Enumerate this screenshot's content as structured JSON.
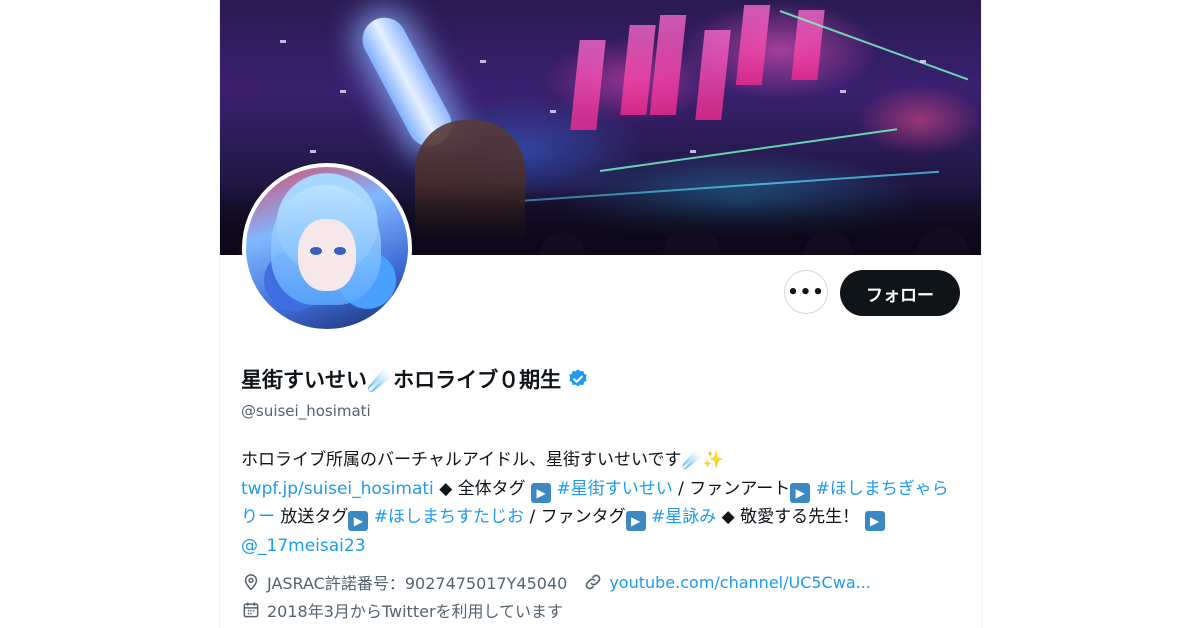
{
  "profile": {
    "display_name": "星街すいせい☄️ホロライブ０期生",
    "handle": "@suisei_hosimati",
    "verified": true,
    "follow_label": "フォロー",
    "more_label": "•••"
  },
  "bio": {
    "line1": "ホロライブ所属のバーチャルアイドル、星街すいせいです☄️✨",
    "profile_link": "twpf.jp/suisei_hosimati",
    "diamond": "◆",
    "all_tag_label": "全体タグ",
    "all_tag": "#星街すいせい",
    "sep": "/",
    "fanart_label": "ファンアート",
    "fanart_tag": "#ほしまちぎゃらりー",
    "stream_tag_label": "放送タグ",
    "stream_tag": "#ほしまちすたじお",
    "fan_tag_label": "ファンタグ",
    "fan_tag": "#星詠み",
    "respect_label": "敬愛する先生！",
    "teacher_handle": "@_17meisai23",
    "play_glyph": "▶"
  },
  "meta": {
    "location": "JASRAC許諾番号：9027475017Y45040",
    "website": "youtube.com/channel/UC5Cwa...",
    "joined": "2018年3月からTwitterを利用しています"
  },
  "colors": {
    "text": "#0f1419",
    "secondary": "#536471",
    "link": "#1d9bf0",
    "verified": "#1d9bf0",
    "follow_bg": "#0f1419"
  }
}
